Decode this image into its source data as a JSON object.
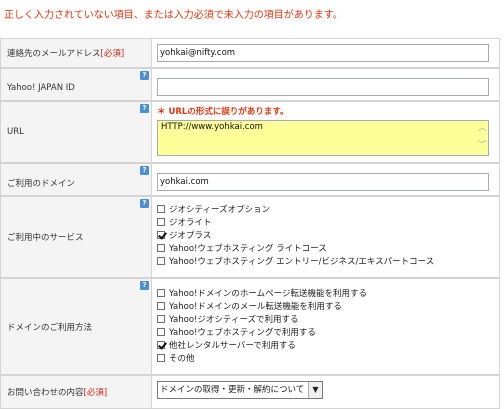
{
  "error_message": "正しく入力されていない項目、または入力必須で未入力の項目があります。",
  "help_label": "?",
  "required_mark": "[必須]",
  "fields": {
    "email": {
      "label": "連絡先のメールアドレス",
      "value": "yohkai@nifty.com"
    },
    "yahoo_id": {
      "label": "Yahoo! JAPAN ID",
      "value": ""
    },
    "url": {
      "label": "URL",
      "error": "＊ URLの形式に誤りがあります。",
      "value": "HTTP://www.yohkai.com"
    },
    "domain": {
      "label": "ご利用のドメイン",
      "value": "yohkai.com"
    },
    "services": {
      "label": "ご利用中のサービス",
      "options": [
        {
          "label": "ジオシティーズオプション",
          "checked": false
        },
        {
          "label": "ジオライト",
          "checked": false
        },
        {
          "label": "ジオプラス",
          "checked": true
        },
        {
          "label": "Yahoo!ウェブホスティング ライトコース",
          "checked": false
        },
        {
          "label": "Yahoo!ウェブホスティング エントリー/ビジネス/エキスパートコース",
          "checked": false
        }
      ]
    },
    "usage": {
      "label": "ドメインのご利用方法",
      "options": [
        {
          "label": "Yahoo!ドメインのホームページ転送機能を利用する",
          "checked": false
        },
        {
          "label": "Yahoo!ドメインのメール転送機能を利用する",
          "checked": false
        },
        {
          "label": "Yahoo!ジオシティーズで利用する",
          "checked": false
        },
        {
          "label": "Yahoo!ウェブホスティングで利用する",
          "checked": false
        },
        {
          "label": "他社レンタルサーバーで利用する",
          "checked": true
        },
        {
          "label": "その他",
          "checked": false
        }
      ]
    },
    "inquiry": {
      "label": "お問い合わせの内容",
      "selected": "ドメインの取得・更新・解約について"
    }
  }
}
